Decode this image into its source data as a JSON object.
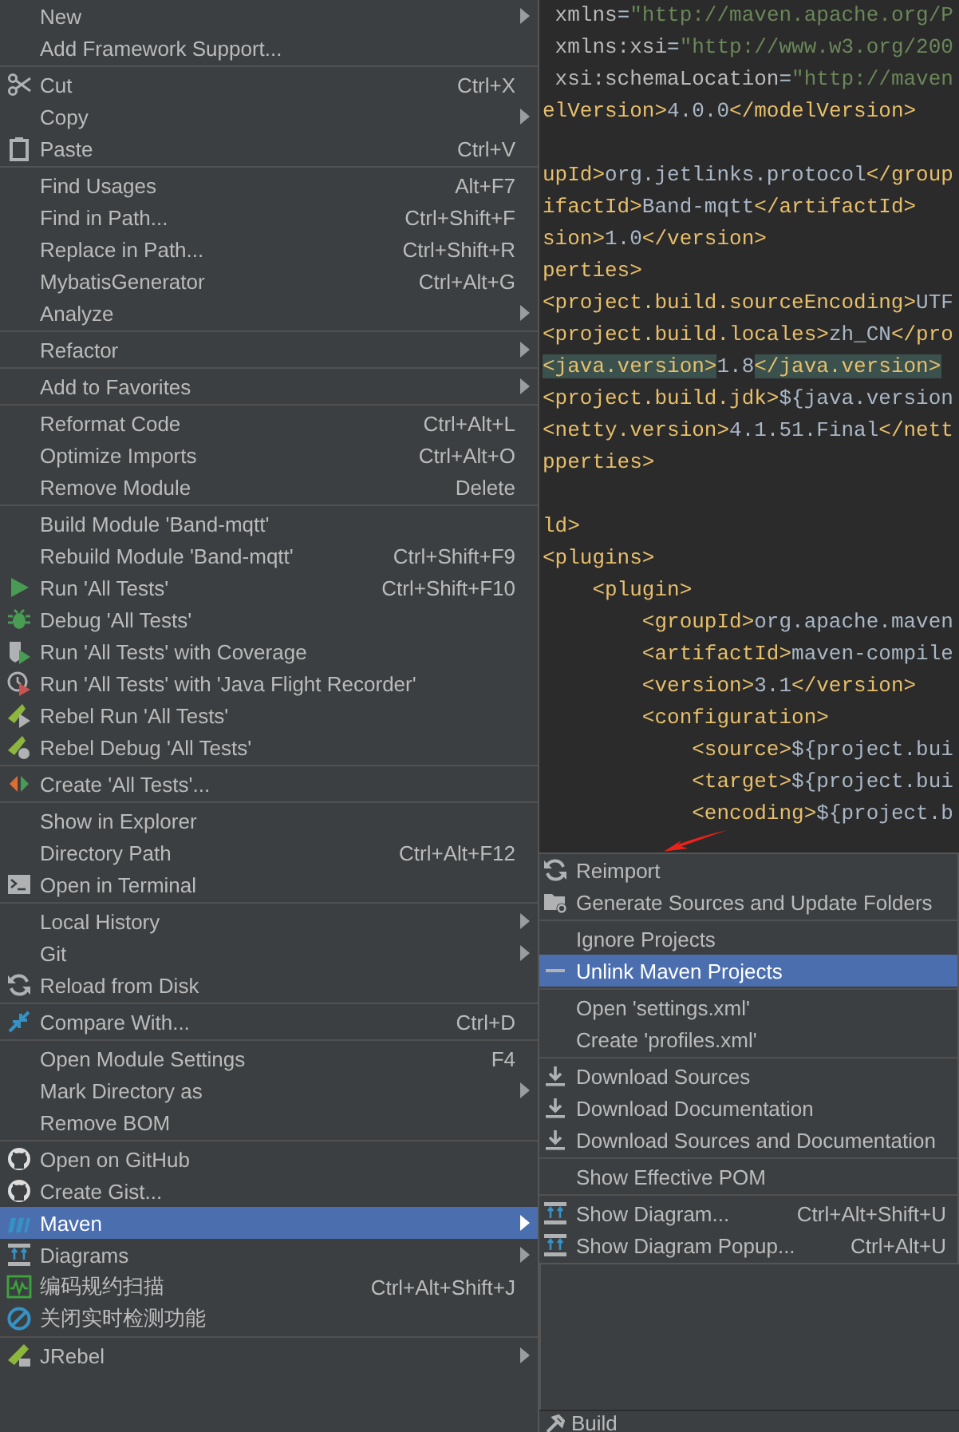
{
  "context_menu": {
    "groups": [
      [
        {
          "label": "New",
          "has_submenu": true,
          "selected": false
        },
        {
          "label": "Add Framework Support...",
          "has_submenu": false,
          "selected": false
        }
      ],
      [
        {
          "label": "Cut",
          "kind": "cut",
          "shortcut": "Ctrl+X",
          "has_submenu": false,
          "selected": false
        },
        {
          "label": "Copy",
          "has_submenu": true,
          "selected": false
        },
        {
          "label": "Paste",
          "kind": "paste",
          "shortcut": "Ctrl+V",
          "has_submenu": false,
          "selected": false
        }
      ],
      [
        {
          "label": "Find Usages",
          "shortcut": "Alt+F7",
          "has_submenu": false,
          "selected": false
        },
        {
          "label": "Find in Path...",
          "shortcut": "Ctrl+Shift+F",
          "has_submenu": false,
          "selected": false
        },
        {
          "label": "Replace in Path...",
          "shortcut": "Ctrl+Shift+R",
          "has_submenu": false,
          "selected": false
        },
        {
          "label": "MybatisGenerator",
          "shortcut": "Ctrl+Alt+G",
          "has_submenu": false,
          "selected": false
        },
        {
          "label": "Analyze",
          "has_submenu": true,
          "selected": false
        }
      ],
      [
        {
          "label": "Refactor",
          "has_submenu": true,
          "selected": false
        }
      ],
      [
        {
          "label": "Add to Favorites",
          "has_submenu": true,
          "selected": false
        }
      ],
      [
        {
          "label": "Reformat Code",
          "shortcut": "Ctrl+Alt+L",
          "has_submenu": false,
          "selected": false
        },
        {
          "label": "Optimize Imports",
          "shortcut": "Ctrl+Alt+O",
          "has_submenu": false,
          "selected": false
        },
        {
          "label": "Remove Module",
          "shortcut": "Delete",
          "has_submenu": false,
          "selected": false
        }
      ],
      [
        {
          "label": "Build Module 'Band-mqtt'",
          "has_submenu": false,
          "selected": false
        },
        {
          "label": "Rebuild Module 'Band-mqtt'",
          "shortcut": "Ctrl+Shift+F9",
          "has_submenu": false,
          "selected": false
        },
        {
          "label": "Run 'All Tests'",
          "kind": "run",
          "shortcut": "Ctrl+Shift+F10",
          "has_submenu": false,
          "selected": false
        },
        {
          "label": "Debug 'All Tests'",
          "kind": "debug",
          "has_submenu": false,
          "selected": false
        },
        {
          "label": "Run 'All Tests' with Coverage",
          "kind": "coverage",
          "has_submenu": false,
          "selected": false
        },
        {
          "label": "Run 'All Tests' with 'Java Flight Recorder'",
          "kind": "profile",
          "has_submenu": false,
          "selected": false
        },
        {
          "label": "Rebel Run 'All Tests'",
          "kind": "rebel_run",
          "has_submenu": false,
          "selected": false
        },
        {
          "label": "Rebel Debug 'All Tests'",
          "kind": "rebel_debug",
          "has_submenu": false,
          "selected": false
        }
      ],
      [
        {
          "label": "Create 'All Tests'...",
          "kind": "create",
          "has_submenu": false,
          "selected": false
        }
      ],
      [
        {
          "label": "Show in Explorer",
          "has_submenu": false,
          "selected": false
        },
        {
          "label": "Directory Path",
          "shortcut": "Ctrl+Alt+F12",
          "has_submenu": false,
          "selected": false
        },
        {
          "label": "Open in Terminal",
          "kind": "terminal",
          "has_submenu": false,
          "selected": false
        }
      ],
      [
        {
          "label": "Local History",
          "has_submenu": true,
          "selected": false
        },
        {
          "label": "Git",
          "has_submenu": true,
          "selected": false
        },
        {
          "label": "Reload from Disk",
          "kind": "reload",
          "has_submenu": false,
          "selected": false
        }
      ],
      [
        {
          "label": "Compare With...",
          "kind": "compare",
          "shortcut": "Ctrl+D",
          "has_submenu": false,
          "selected": false
        }
      ],
      [
        {
          "label": "Open Module Settings",
          "shortcut": "F4",
          "has_submenu": false,
          "selected": false
        },
        {
          "label": "Mark Directory as",
          "has_submenu": true,
          "selected": false
        },
        {
          "label": "Remove BOM",
          "has_submenu": false,
          "selected": false
        }
      ],
      [
        {
          "label": "Open on GitHub",
          "kind": "github",
          "has_submenu": false,
          "selected": false
        },
        {
          "label": "Create Gist...",
          "kind": "github",
          "has_submenu": false,
          "selected": false
        },
        {
          "label": "Maven",
          "kind": "maven",
          "has_submenu": true,
          "selected": true
        },
        {
          "label": "Diagrams",
          "kind": "diagram",
          "has_submenu": true,
          "selected": false
        },
        {
          "label": "编码规约扫描",
          "kind": "scan",
          "shortcut": "Ctrl+Alt+Shift+J",
          "has_submenu": false,
          "selected": false
        },
        {
          "label": "关闭实时检测功能",
          "kind": "forbid",
          "has_submenu": false,
          "selected": false
        }
      ],
      [
        {
          "label": "JRebel",
          "kind": "jrebel",
          "has_submenu": true,
          "selected": false
        }
      ]
    ]
  },
  "editor": {
    "lines": [
      {
        "kind": "code",
        "segments": [
          {
            "kind": "attr",
            "text": " xmlns"
          },
          {
            "kind": "text",
            "text": "="
          },
          {
            "kind": "string",
            "text": "\"http://maven.apache.org/P"
          }
        ]
      },
      {
        "kind": "code",
        "segments": [
          {
            "kind": "attr",
            "text": " xmlns:xsi"
          },
          {
            "kind": "text",
            "text": "="
          },
          {
            "kind": "string",
            "text": "\"http://www.w3.org/200"
          }
        ]
      },
      {
        "kind": "code",
        "segments": [
          {
            "kind": "attr",
            "text": " xsi:schemaLocation"
          },
          {
            "kind": "text",
            "text": "="
          },
          {
            "kind": "string",
            "text": "\"http://maven"
          }
        ]
      },
      {
        "kind": "code",
        "segments": [
          {
            "kind": "tag",
            "text": "elVersion>"
          },
          {
            "kind": "text",
            "text": "4.0.0"
          },
          {
            "kind": "tag",
            "text": "</modelVersion>"
          }
        ]
      },
      {
        "kind": "blank"
      },
      {
        "kind": "code",
        "segments": [
          {
            "kind": "tag",
            "text": "upId>"
          },
          {
            "kind": "text",
            "text": "org.jetlinks.protocol"
          },
          {
            "kind": "tag",
            "text": "</group"
          }
        ]
      },
      {
        "kind": "code",
        "segments": [
          {
            "kind": "tag",
            "text": "ifactId>"
          },
          {
            "kind": "text",
            "text": "Band-mqtt"
          },
          {
            "kind": "tag",
            "text": "</artifactId>"
          }
        ]
      },
      {
        "kind": "code",
        "segments": [
          {
            "kind": "tag",
            "text": "sion>"
          },
          {
            "kind": "text",
            "text": "1.0"
          },
          {
            "kind": "tag",
            "text": "</version>"
          }
        ]
      },
      {
        "kind": "code",
        "segments": [
          {
            "kind": "tag",
            "text": "perties>"
          }
        ]
      },
      {
        "kind": "code",
        "segments": [
          {
            "kind": "tag",
            "text": "<project.build.sourceEncoding>"
          },
          {
            "kind": "text",
            "text": "UTF"
          }
        ]
      },
      {
        "kind": "code",
        "segments": [
          {
            "kind": "tag",
            "text": "<project.build.locales>"
          },
          {
            "kind": "text",
            "text": "zh_CN"
          },
          {
            "kind": "tag",
            "text": "</pro"
          }
        ]
      },
      {
        "kind": "code",
        "segments": [
          {
            "kind": "tag_matched",
            "text": "<java.version>"
          },
          {
            "kind": "text",
            "text": "1.8"
          },
          {
            "kind": "tag_matched",
            "text": "</java.version>"
          }
        ]
      },
      {
        "kind": "code",
        "segments": [
          {
            "kind": "tag",
            "text": "<project.build.jdk>"
          },
          {
            "kind": "text",
            "text": "${java.version"
          }
        ]
      },
      {
        "kind": "code",
        "segments": [
          {
            "kind": "tag",
            "text": "<netty.version>"
          },
          {
            "kind": "text",
            "text": "4.1.51.Final"
          },
          {
            "kind": "tag",
            "text": "</nett"
          }
        ]
      },
      {
        "kind": "code",
        "segments": [
          {
            "kind": "tag",
            "text": "pperties>"
          }
        ]
      },
      {
        "kind": "blank"
      },
      {
        "kind": "code",
        "segments": [
          {
            "kind": "tag",
            "text": "ld>"
          }
        ]
      },
      {
        "kind": "code",
        "segments": [
          {
            "kind": "tag",
            "text": "<plugins>"
          }
        ]
      },
      {
        "kind": "code",
        "segments": [
          {
            "kind": "tag",
            "text": "    <plugin>"
          }
        ]
      },
      {
        "kind": "code",
        "segments": [
          {
            "kind": "tag",
            "text": "        <groupId>"
          },
          {
            "kind": "text",
            "text": "org.apache.maven"
          }
        ]
      },
      {
        "kind": "code",
        "segments": [
          {
            "kind": "tag",
            "text": "        <artifactId>"
          },
          {
            "kind": "text",
            "text": "maven-compile"
          }
        ]
      },
      {
        "kind": "code",
        "segments": [
          {
            "kind": "tag",
            "text": "        <version>"
          },
          {
            "kind": "text",
            "text": "3.1"
          },
          {
            "kind": "tag",
            "text": "</version>"
          }
        ]
      },
      {
        "kind": "code",
        "segments": [
          {
            "kind": "tag",
            "text": "        <configuration>"
          }
        ]
      },
      {
        "kind": "code",
        "segments": [
          {
            "kind": "tag",
            "text": "            <source>"
          },
          {
            "kind": "text",
            "text": "${project.bui"
          }
        ]
      },
      {
        "kind": "code",
        "segments": [
          {
            "kind": "tag",
            "text": "            <target>"
          },
          {
            "kind": "text",
            "text": "${project.bui"
          }
        ]
      },
      {
        "kind": "code",
        "segments": [
          {
            "kind": "tag",
            "text": "            <encoding>"
          },
          {
            "kind": "text",
            "text": "${project.b"
          }
        ]
      }
    ]
  },
  "maven_submenu": {
    "groups": [
      [
        {
          "label": "Reimport",
          "kind": "reload",
          "selected": false
        },
        {
          "label": "Generate Sources and Update Folders",
          "kind": "generate",
          "selected": false
        }
      ],
      [
        {
          "label": "Ignore Projects",
          "selected": false
        },
        {
          "label": "Unlink Maven Projects",
          "kind": "minus",
          "selected": true
        }
      ],
      [
        {
          "label": "Open 'settings.xml'",
          "selected": false
        },
        {
          "label": "Create 'profiles.xml'",
          "selected": false
        }
      ],
      [
        {
          "label": "Download Sources",
          "kind": "download",
          "selected": false
        },
        {
          "label": "Download Documentation",
          "kind": "download",
          "selected": false
        },
        {
          "label": "Download Sources and Documentation",
          "kind": "download",
          "selected": false
        }
      ],
      [
        {
          "label": "Show Effective POM",
          "selected": false
        }
      ],
      [
        {
          "label": "Show Diagram...",
          "kind": "diagram",
          "shortcut": "Ctrl+Alt+Shift+U",
          "selected": false
        },
        {
          "label": "Show Diagram Popup...",
          "kind": "diagram",
          "shortcut": "Ctrl+Alt+U",
          "selected": false
        }
      ]
    ]
  },
  "bottom_tab": {
    "label": "Build"
  }
}
